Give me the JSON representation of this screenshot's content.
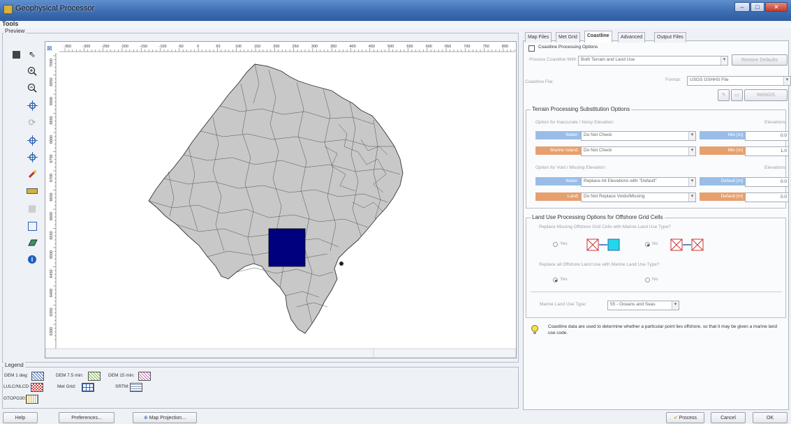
{
  "window": {
    "title": "Geophysical Processor",
    "controls": [
      "–",
      "□",
      "✕"
    ]
  },
  "menu": {
    "tools": "Tools"
  },
  "preview": {
    "label": "Preview",
    "ruler_x": [
      "-350",
      "-300",
      "-250",
      "-200",
      "-150",
      "-100",
      "-50",
      "0",
      "50",
      "100",
      "150",
      "200",
      "250",
      "300",
      "350",
      "400",
      "450",
      "500",
      "550",
      "600",
      "650",
      "700",
      "750",
      "800"
    ],
    "ruler_y": [
      "7000",
      "6950",
      "6900",
      "6850",
      "6800",
      "6750",
      "6700",
      "6650",
      "6600",
      "6550",
      "6500",
      "6450",
      "6400",
      "6350",
      "6300"
    ]
  },
  "legend": {
    "label": "Legend",
    "items": [
      {
        "label": "DEM 1 deg:",
        "icon": "blue-diagonal-hatch"
      },
      {
        "label": "DEM 7.5 min:",
        "icon": "green-diagonal-hatch"
      },
      {
        "label": "DEM 15 min:",
        "icon": "pink-diagonal-hatch"
      },
      {
        "label": "LULC/NLCD:",
        "icon": "red-check-pattern"
      },
      {
        "label": "Met Grid:",
        "icon": "blue-grid"
      },
      {
        "label": "SRTM:",
        "icon": "gray-horizontal-lines"
      },
      {
        "label": "GTOPO30:",
        "icon": "yellow-vertical-lines"
      }
    ]
  },
  "tabs": [
    "Map Files",
    "Met Grid",
    "Coastline",
    "Advanced",
    "Output Files"
  ],
  "active_tab": "Coastline",
  "coastline": {
    "checkbox_label": "Coastline Processing Options",
    "process_with_label": "Process Coastline With:",
    "process_with_value": "Both Terrain and Land Use",
    "restore_defaults": "Restore Defaults",
    "file_label": "Coastline File:",
    "format_label": "Format:",
    "format_value": "USGS GSHHS File",
    "webgis_label": "WebGIS"
  },
  "terrain": {
    "title": "Terrain Processing Substitution Options",
    "inaccurate_label": "Option for Inaccurate / Noisy Elevation:",
    "elevations_label": "Elevations",
    "rows1": [
      {
        "tag": "Water:",
        "value": "Do Not Check",
        "unit": "Min [m]",
        "num": "0.0",
        "color": "blue"
      },
      {
        "tag": "Marine Island:",
        "value": "Do Not Check",
        "unit": "Min [m]",
        "num": "1.0",
        "color": "orange"
      }
    ],
    "void_label": "Option for Void / Missing Elevation:",
    "rows2": [
      {
        "tag": "Water:",
        "value": "Replace All Elevations with \"Default\"",
        "unit": "Default [m]",
        "num": "0.0",
        "color": "blue"
      },
      {
        "tag": "Land:",
        "value": "Do Not Replace Voids/Missing",
        "unit": "Default [m]",
        "num": "0.0",
        "color": "orange"
      }
    ]
  },
  "landuse": {
    "title": "Land Use Processing Options for Offshore Grid Cells",
    "q1": "Replace Missing Offshore Grid Cells with Marine Land Use Type?",
    "q2": "Replace all Offshore Land Use with Marine Land Use Type?",
    "yes": "Yes",
    "no": "No",
    "q1_selected": "No",
    "q2_selected": "Yes",
    "marine_type_label": "Marine Land Use Type:",
    "marine_type_value": "55 - Oceans and Seas"
  },
  "hint": "Coastline data are used to determine whether a particular point lies offshore, so that it may be given a marine land use code.",
  "footer": {
    "help": "Help",
    "preferences": "Preferences...",
    "map_projection": "Map Projection...",
    "process": "Process",
    "cancel": "Cancel",
    "ok": "OK"
  },
  "colors": {
    "map_fill": "#c8c8c8",
    "selection": "#00007e",
    "water_tag": "#99bde7",
    "land_tag": "#e6a06e",
    "titlebar": "#3b6bb0"
  }
}
